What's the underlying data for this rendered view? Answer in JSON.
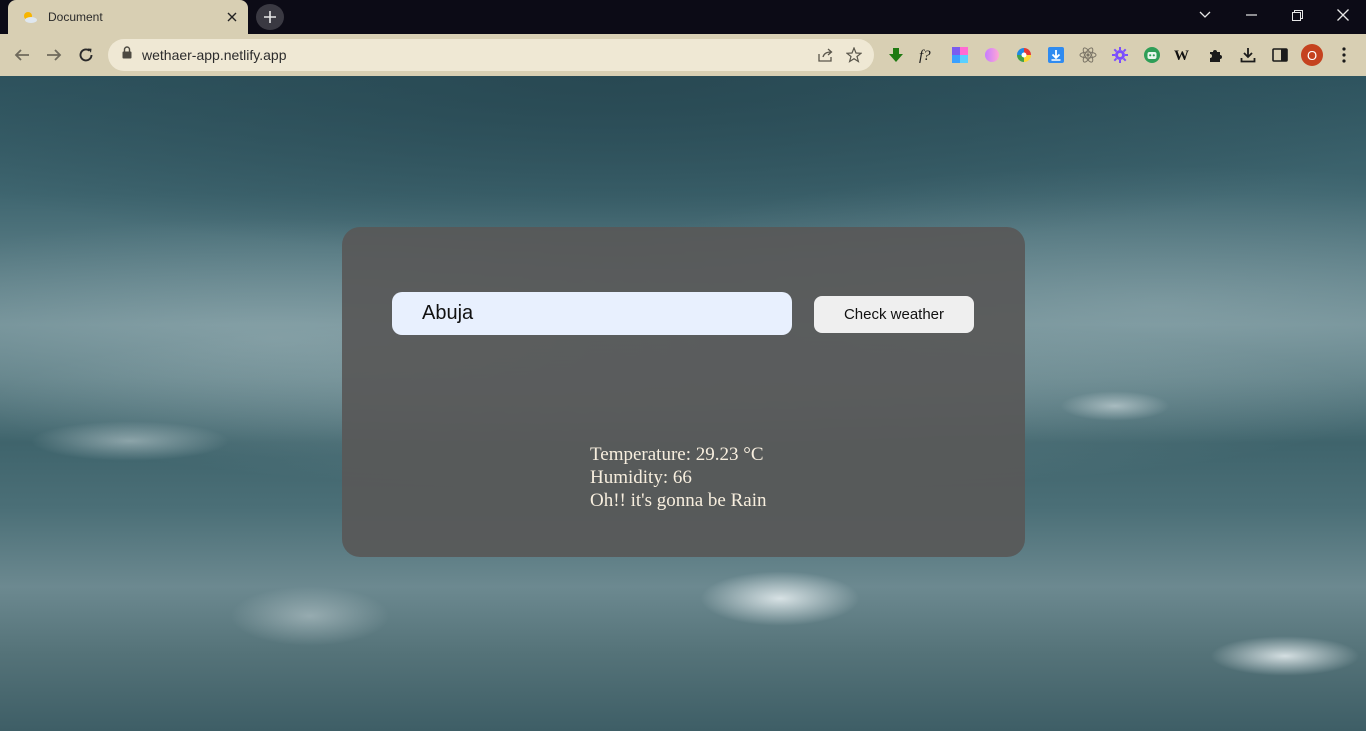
{
  "browser": {
    "tab": {
      "title": "Document",
      "favicon": "weather-sun-cloud-icon"
    },
    "address_bar": {
      "url": "wethaer-app.netlify.app"
    },
    "profile_initial": "O",
    "colors": {
      "frame": "#0c0b16",
      "toolbar": "#d8cfb3",
      "omnibox": "#efe8d4",
      "profile": "#c5421f"
    },
    "extensions": [
      "download-arrow-icon",
      "font-question-icon",
      "color-blocks-icon",
      "gradient-blob-icon",
      "color-wheel-icon",
      "blue-download-icon",
      "react-atom-icon",
      "purple-gear-icon",
      "green-robot-icon",
      "wikipedia-icon",
      "puzzle-icon"
    ]
  },
  "app": {
    "search": {
      "value": "Abuja"
    },
    "button_label": "Check weather",
    "result": {
      "temperature": "Temperature: 29.23 °C",
      "humidity": "Humidity: 66",
      "condition": "Oh!! it's gonna be Rain"
    },
    "colors": {
      "card": "#585858",
      "input_bg": "#e8f0fe",
      "result_text": "#f7eede"
    }
  }
}
